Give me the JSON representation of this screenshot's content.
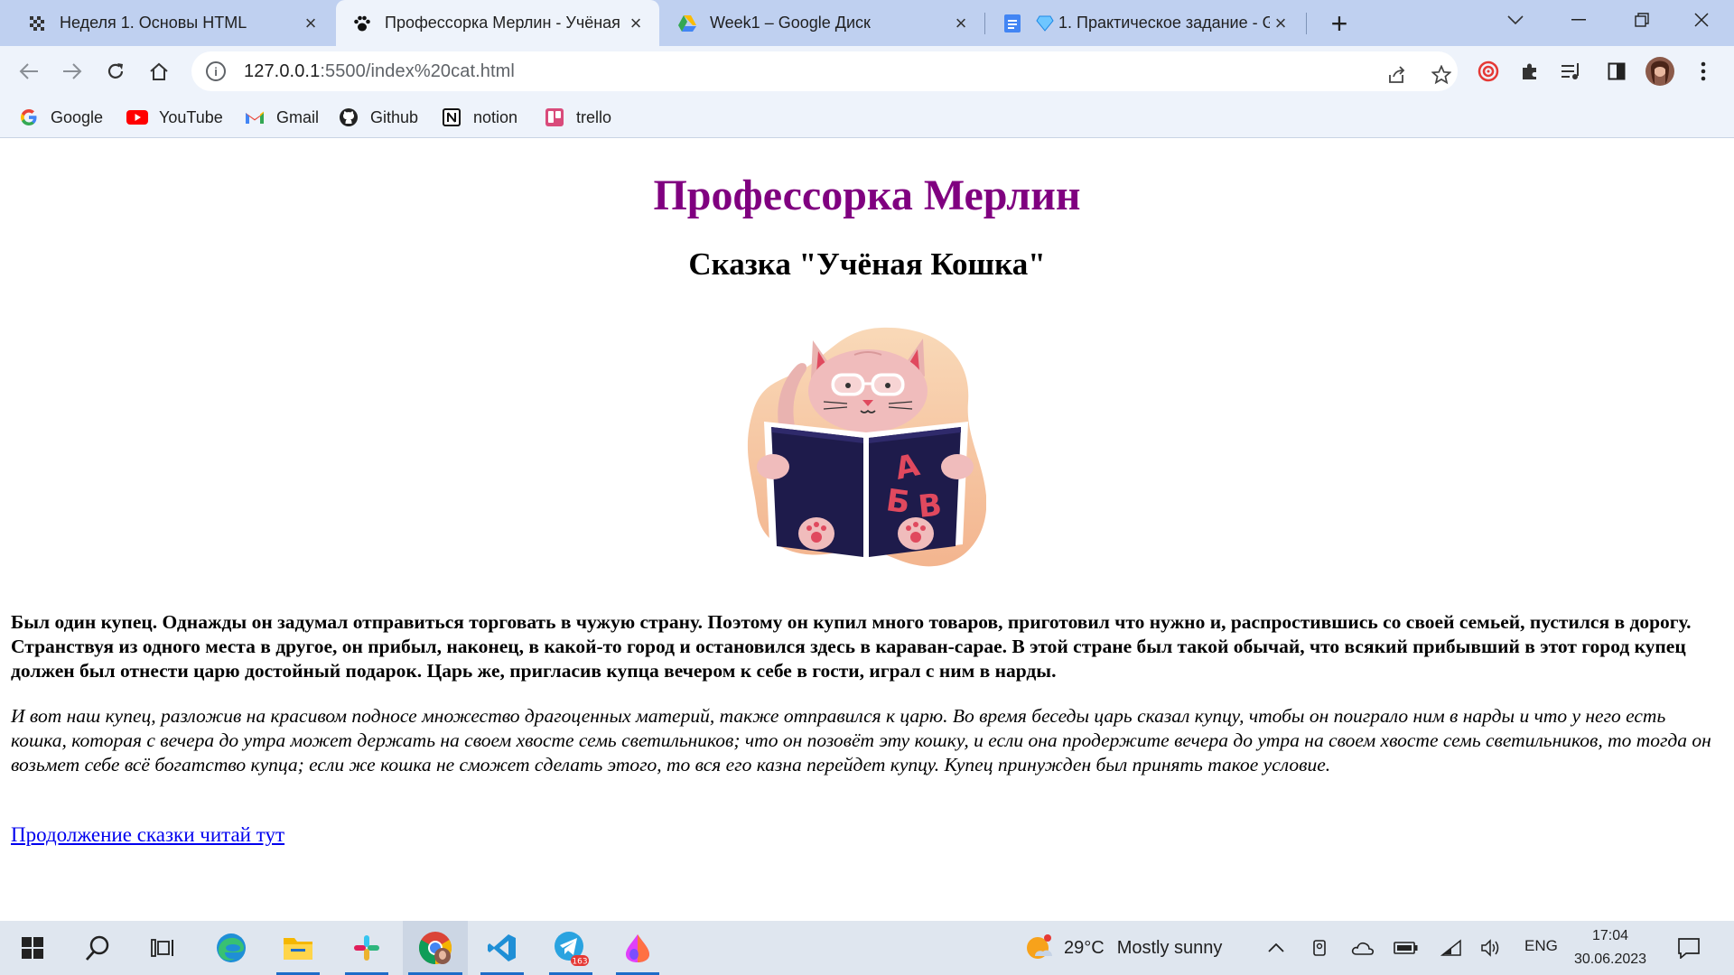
{
  "browser": {
    "tabs": [
      {
        "title": "Неделя 1. Основы HTML",
        "favicon": "checkered-flag-icon",
        "active": false
      },
      {
        "title": "Профессорка Мерлин - Учёная",
        "favicon": "paw-icon",
        "active": true
      },
      {
        "title": "Week1 – Google Диск",
        "favicon": "google-drive-icon",
        "active": false
      },
      {
        "title": "1. Практическое задание - G",
        "favicon": "google-docs-icon",
        "active": false
      }
    ],
    "url_host": "127.0.0.1",
    "url_path": ":5500/index%20cat.html",
    "bookmarks": [
      {
        "label": "Google",
        "icon": "google-icon"
      },
      {
        "label": "YouTube",
        "icon": "youtube-icon"
      },
      {
        "label": "Gmail",
        "icon": "gmail-icon"
      },
      {
        "label": "Github",
        "icon": "github-icon"
      },
      {
        "label": "notion",
        "icon": "notion-icon"
      },
      {
        "label": "trello",
        "icon": "trello-icon"
      }
    ]
  },
  "page": {
    "title": "Профессорка Мерлин",
    "subtitle": "Сказка \"Учёная Кошка\"",
    "image_letters": [
      "А",
      "Б",
      "В"
    ],
    "paragraph_bold": "Был один купец. Однажды он задумал отправиться торговать в чужую страну. Поэтому он купил много товаров, приготовил что нужно и, распростившись со своей семьей, пустился в дорогу. Странствуя из одного места в другое, он прибыл, наконец, в какой-то город и остановился здесь в караван-сарае. В этой стране был такой обычай, что всякий прибывший в этот город купец должен был отнести царю достойный подарок. Царь же, пригласив купца вечером к себе в гости, играл с ним в нарды.",
    "paragraph_italic": "И вот наш купец, разложив на красивом подносе множество драгоценных материй, также отправился к царю. Во время беседы царь сказал купцу, чтобы он поиграло ним в нарды и что у него есть кошка, которая с вечера до утра может держать на своем хвосте семь светильников; что он позовёт эту кошку, и если она продержите вечера до утра на своем хвосте семь светильников, то тогда он возьмет себе всё богатство купца; если же кошка не сможет сделать этого, то вся его казна перейдет купцу. Купец принужден был принять такое условие.",
    "link": "Продолжение сказки читай тут"
  },
  "taskbar": {
    "weather_temp": "29°C",
    "weather_text": "Mostly sunny",
    "language": "ENG",
    "time": "17:04",
    "date": "30.06.2023",
    "telegram_badge": "163"
  },
  "colors": {
    "title": "#800080",
    "link": "#0000ee",
    "tabstrip": "#bfd0f0",
    "toolbar": "#eef3fb"
  }
}
